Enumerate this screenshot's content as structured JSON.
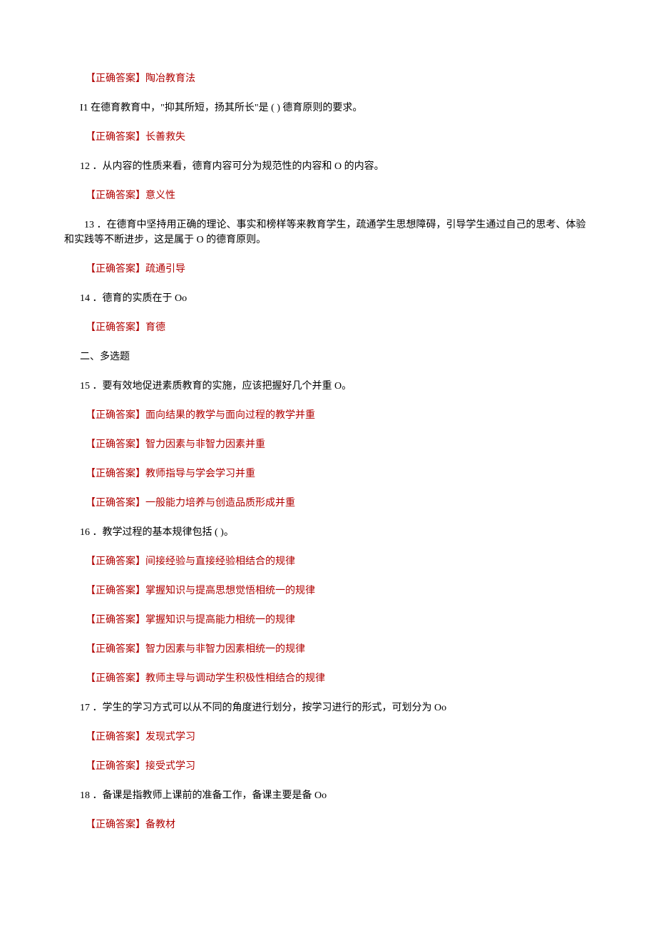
{
  "items": [
    {
      "type": "answer",
      "indent": "indent2",
      "text": "【正确答案】陶冶教育法"
    },
    {
      "type": "question",
      "indent": "indent1",
      "text": "I1 在德育教育中，\"抑其所短，扬其所长\"是 ( ) 德育原则的要求。"
    },
    {
      "type": "answer",
      "indent": "indent2",
      "text": "【正确答案】长善救失"
    },
    {
      "type": "question",
      "indent": "indent1",
      "text": "12 ．从内容的性质来看，德育内容可分为规范性的内容和 O 的内容。"
    },
    {
      "type": "answer",
      "indent": "indent2",
      "text": "【正确答案】意义性"
    },
    {
      "type": "question",
      "indent": "",
      "text": "　　13 ．在德育中坚持用正确的理论、事实和榜样等来教育学生，疏通学生思想障碍，引导学生通过自己的思考、体验和实践等不断进步，这是属于 O 的德育原则。"
    },
    {
      "type": "answer",
      "indent": "indent2",
      "text": "【正确答案】疏通引导"
    },
    {
      "type": "question",
      "indent": "indent1",
      "text": "14 ．德育的实质在于 Oo"
    },
    {
      "type": "answer",
      "indent": "indent2",
      "text": "【正确答案】育德"
    },
    {
      "type": "section",
      "indent": "indent1",
      "text": "二、多选题"
    },
    {
      "type": "question",
      "indent": "indent1",
      "text": "15 ．要有效地促进素质教育的实施，应该把握好几个并重 O。"
    },
    {
      "type": "answer",
      "indent": "indent2",
      "text": "【正确答案】面向结果的教学与面向过程的教学并重"
    },
    {
      "type": "answer",
      "indent": "indent2",
      "text": "【正确答案】智力因素与非智力因素并重"
    },
    {
      "type": "answer",
      "indent": "indent2",
      "text": "【正确答案】教师指导与学会学习并重"
    },
    {
      "type": "answer",
      "indent": "indent2",
      "text": "【正确答案】一般能力培养与创造品质形成并重"
    },
    {
      "type": "question",
      "indent": "indent1",
      "text": "16 ．教学过程的基本规律包括 ( )。"
    },
    {
      "type": "answer",
      "indent": "indent2",
      "text": "【正确答案】间接经验与直接经验相结合的规律"
    },
    {
      "type": "answer",
      "indent": "indent2",
      "text": "【正确答案】掌握知识与提高思想觉悟相统一的规律"
    },
    {
      "type": "answer",
      "indent": "indent2",
      "text": "【正确答案】掌握知识与提高能力相统一的规律"
    },
    {
      "type": "answer",
      "indent": "indent2",
      "text": "【正确答案】智力因素与非智力因素相统一的规律"
    },
    {
      "type": "answer",
      "indent": "indent2",
      "text": "【正确答案】教师主导与调动学生积极性相结合的规律"
    },
    {
      "type": "question",
      "indent": "indent1",
      "text": "17 ．学生的学习方式可以从不同的角度进行划分，按学习进行的形式，可划分为 Oo"
    },
    {
      "type": "answer",
      "indent": "indent2",
      "text": "【正确答案】发现式学习"
    },
    {
      "type": "answer",
      "indent": "indent2",
      "text": "【正确答案】接受式学习"
    },
    {
      "type": "question",
      "indent": "indent1",
      "text": "18 ．备课是指教师上课前的准备工作，备课主要是备 Oo"
    },
    {
      "type": "answer",
      "indent": "indent2",
      "text": "【正确答案】备教材"
    }
  ]
}
